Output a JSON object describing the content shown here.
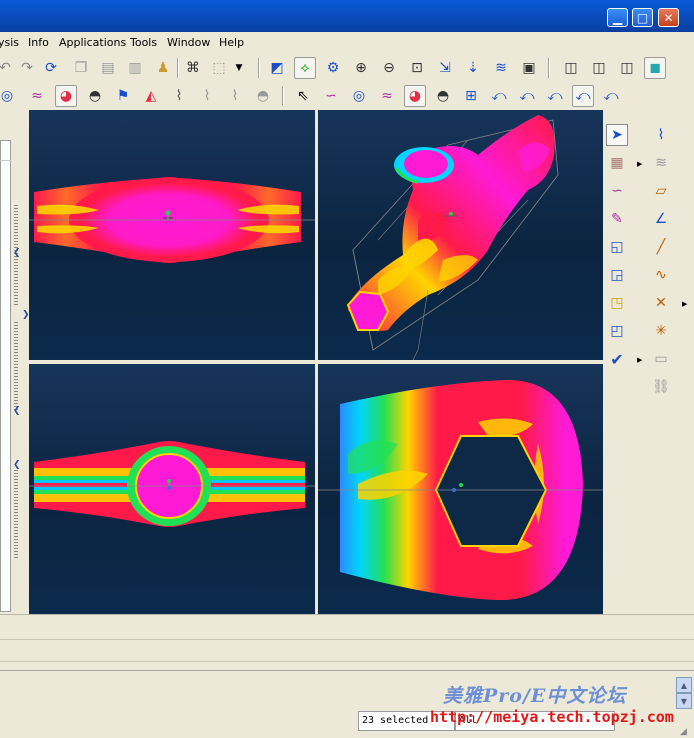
{
  "window": {
    "minimize_glyph": "▁",
    "maximize_glyph": "□",
    "close_glyph": "✕"
  },
  "menu": {
    "items": [
      "ysis",
      "Info",
      "Applications",
      "Tools",
      "Window",
      "Help"
    ]
  },
  "toolbar_icons": {
    "row1": [
      "undo-icon",
      "redo-icon",
      "regenerate-icon",
      "copy-icon",
      "paste-icon",
      "paste-special-icon",
      "color-icon",
      "binoculars-icon",
      "selection-box-icon",
      "dropdown-icon",
      "repaint-icon",
      "spin-center-icon",
      "orient-icon",
      "zoom-in-icon",
      "zoom-out-icon",
      "refit-icon",
      "view-manager-icon",
      "saved-views-icon",
      "layers-icon",
      "appearance-icon",
      "wireframe-icon",
      "hidden-line-icon",
      "no-hidden-icon",
      "shading-icon"
    ],
    "row2": [
      "curvature-analysis-icon",
      "curve-analysis-icon",
      "shade-analysis-icon",
      "dihedral-analysis-icon",
      "draft-analysis-icon",
      "reflection-analysis-icon",
      "offset-analysis-icon",
      "deviation-analysis-icon",
      "slope-analysis-icon",
      "section-analysis-icon",
      "context-help-icon",
      "curve-edit-icon",
      "surface-curvature-icon",
      "surface-curve-icon",
      "shaded-curvature-icon",
      "distance-icon",
      "measure-1-icon",
      "measure-2-icon",
      "measure-3-icon",
      "measure-4-icon",
      "measure-5-icon",
      "measure-6-icon"
    ]
  },
  "palette_icons": {
    "left": [
      "select-arrow-icon",
      "plane-icon",
      "curve-icon",
      "sketch-curve-icon",
      "boundary-surface-icon",
      "sweep-surface-icon",
      "blend-surface-icon",
      "fill-surface-icon",
      "accept-check-icon"
    ],
    "right": [
      "curve-edit-icon",
      "offset-curve-icon",
      "datum-plane-icon",
      "datum-axis-icon",
      "datum-line-icon",
      "free-curve-icon",
      "points-icon",
      "intersect-icon",
      "ruler-icon",
      "chain-icon"
    ]
  },
  "status": {
    "watermark": "美雅Pro/E中文论坛",
    "selected": "23 selected",
    "filter": "All",
    "url": "http://meiya.tech.topzj.com"
  },
  "colors": {
    "titlebar": "#0a53c4",
    "viewport_background": "#0e2946",
    "analysis_high": "#ff1a4a",
    "analysis_peak": "#ff1ad6",
    "analysis_mid": "#ffe600",
    "analysis_low": "#00d4ff",
    "watermark": "#6d8fd6",
    "url": "#e01818"
  }
}
